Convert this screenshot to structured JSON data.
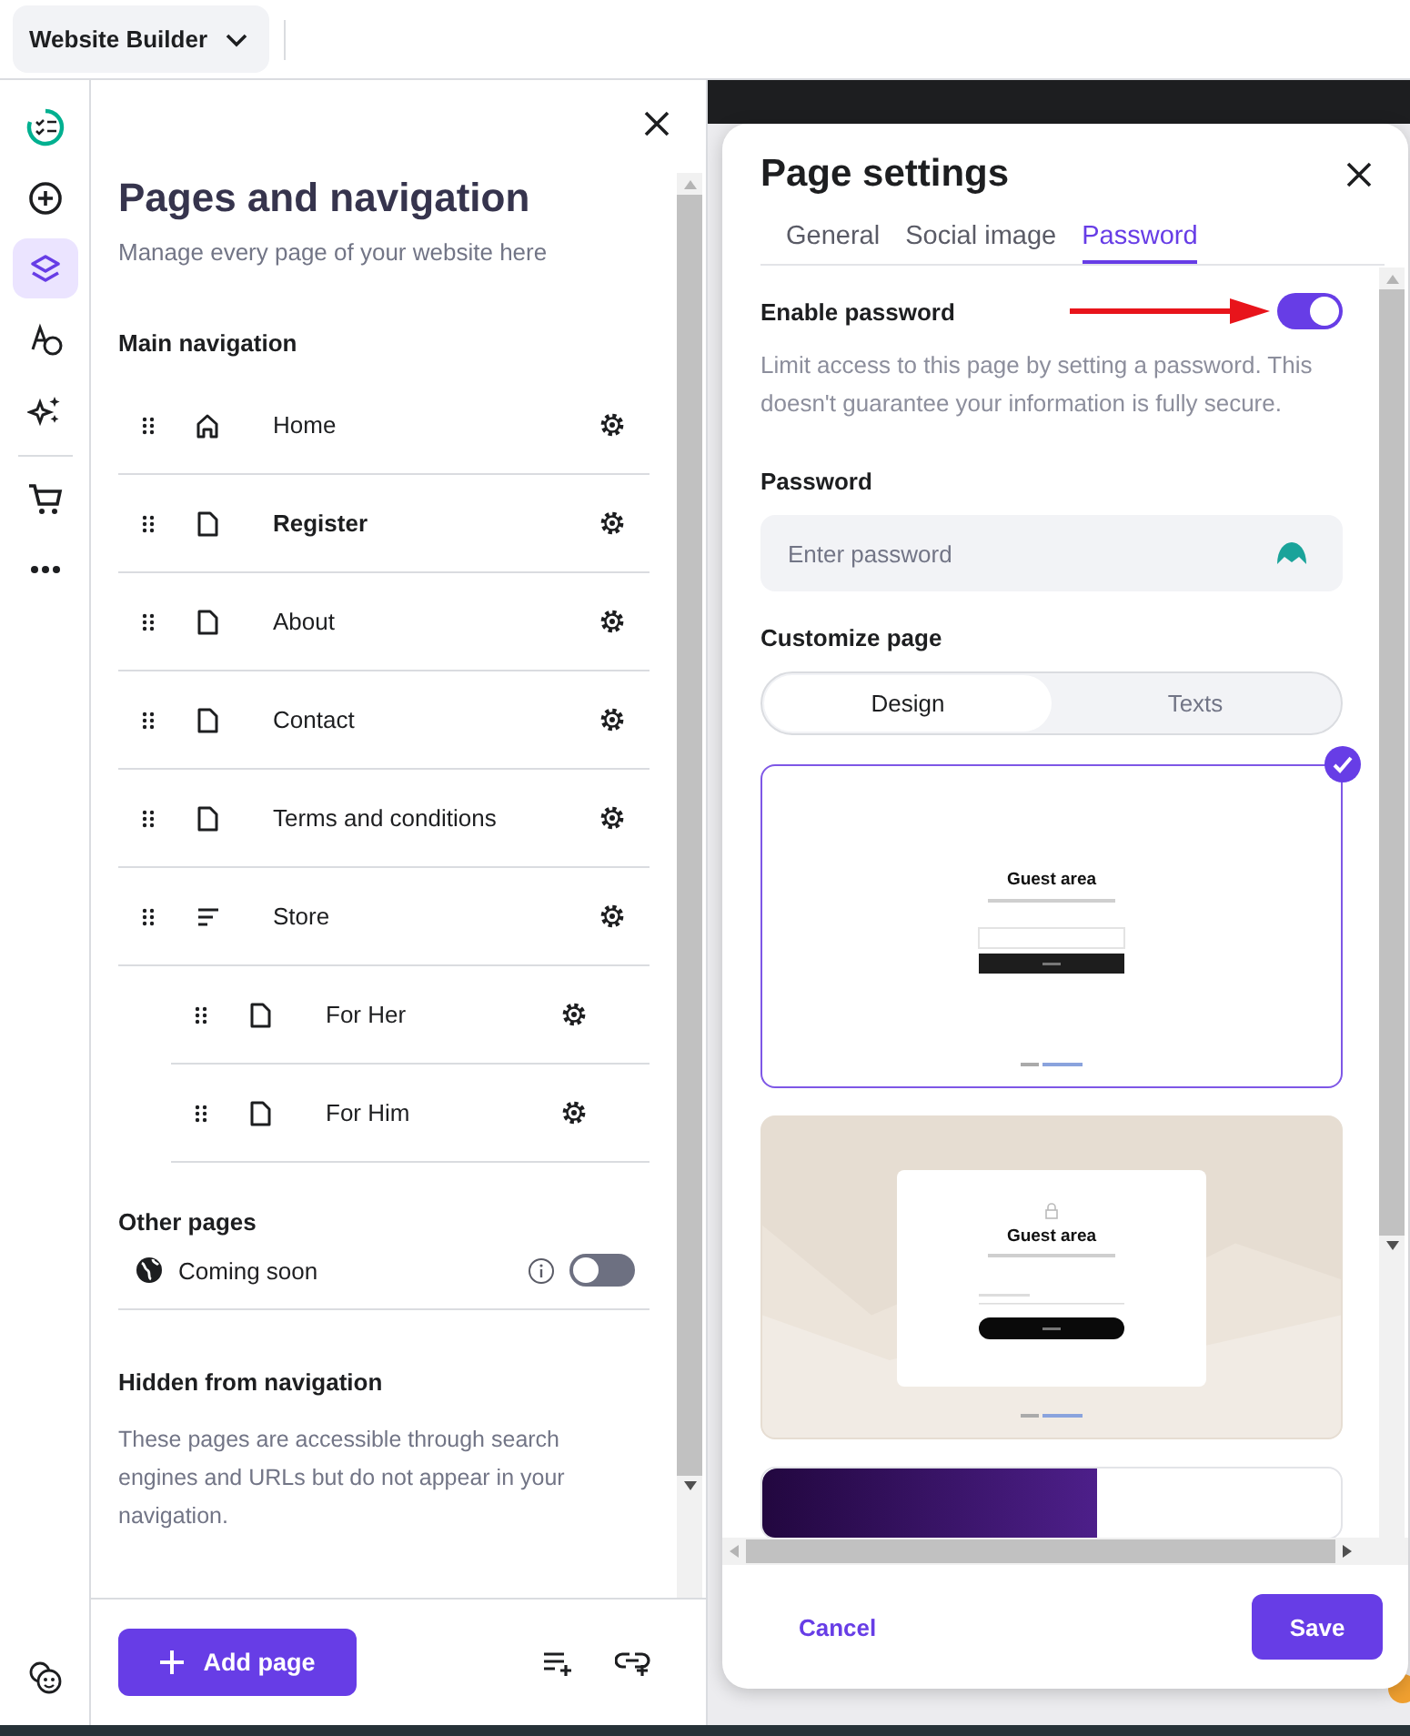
{
  "top_bar": {
    "app_menu": "Website Builder"
  },
  "rail": {
    "items": [
      {
        "selected": false
      },
      {
        "selected": false
      },
      {
        "selected": true
      },
      {
        "selected": false
      },
      {
        "selected": false
      },
      {
        "selected": false
      },
      {
        "selected": false
      }
    ]
  },
  "pages_panel": {
    "title": "Pages and navigation",
    "subtitle": "Manage every page of your website here",
    "main_navigation": {
      "heading": "Main navigation",
      "items": [
        {
          "label": "Home",
          "kind": "home",
          "selected": false
        },
        {
          "label": "Register",
          "kind": "page",
          "selected": true
        },
        {
          "label": "About",
          "kind": "page",
          "selected": false
        },
        {
          "label": "Contact",
          "kind": "page",
          "selected": false
        },
        {
          "label": "Terms and conditions",
          "kind": "page",
          "selected": false
        },
        {
          "label": "Store",
          "kind": "store",
          "selected": false,
          "children": [
            {
              "label": "For Her",
              "kind": "page",
              "selected": false
            },
            {
              "label": "For Him",
              "kind": "page",
              "selected": false
            }
          ]
        }
      ]
    },
    "other_pages": {
      "heading": "Other pages",
      "items": [
        {
          "label": "Coming soon",
          "on": false
        }
      ]
    },
    "hidden": {
      "heading": "Hidden from navigation",
      "description": "These pages are accessible through search engines and URLs but do not appear in your navigation."
    },
    "add_page": "Add page"
  },
  "page_settings": {
    "title": "Page settings",
    "tabs": [
      {
        "label": "General",
        "selected": false
      },
      {
        "label": "Social image",
        "selected": false
      },
      {
        "label": "Password",
        "selected": true
      }
    ],
    "enable_password": {
      "label": "Enable password",
      "on": true
    },
    "description": "Limit access to this page by setting a password. This doesn't guarantee your information is fully secure.",
    "password": {
      "label": "Password",
      "placeholder": "Enter password"
    },
    "customize": {
      "label": "Customize page",
      "segments": [
        {
          "label": "Design",
          "selected": true
        },
        {
          "label": "Texts",
          "selected": false
        }
      ],
      "templates": [
        {
          "kind": "plain",
          "selected": true,
          "title": "Guest area"
        },
        {
          "kind": "beige",
          "selected": false,
          "title": "Guest area"
        },
        {
          "kind": "dark",
          "selected": false
        }
      ]
    },
    "cancel": "Cancel",
    "save": "Save"
  }
}
